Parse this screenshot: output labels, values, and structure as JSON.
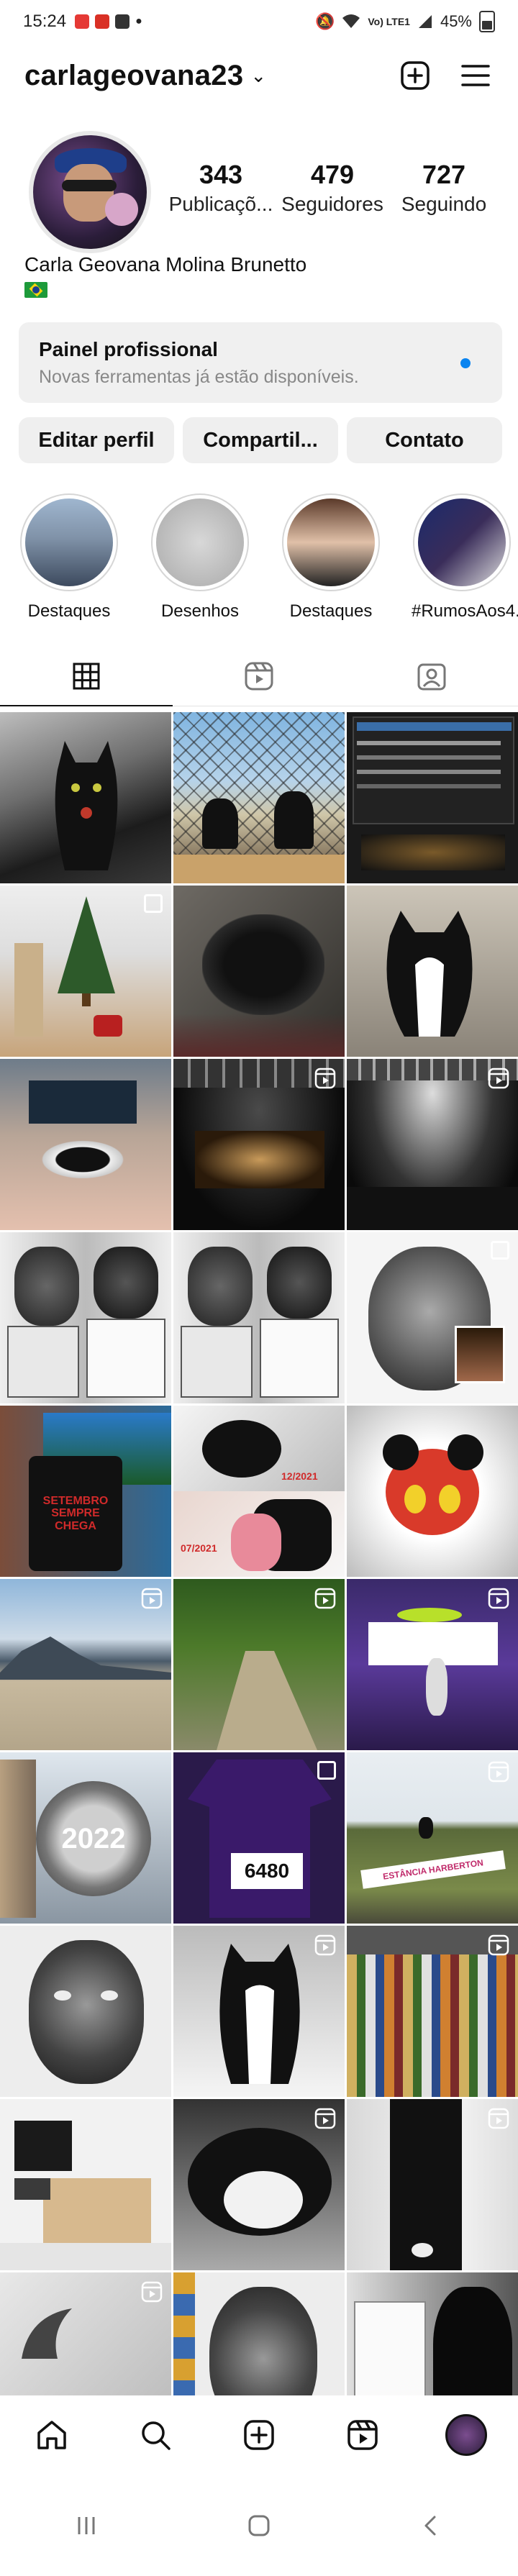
{
  "status_bar": {
    "time": "15:24",
    "network": "Vo) LTE1",
    "battery": "45%"
  },
  "header": {
    "username": "carlageovana23"
  },
  "profile": {
    "full_name": "Carla Geovana Molina Brunetto",
    "flag_icon": "brazil-flag-icon",
    "stats": [
      {
        "value": "343",
        "label": "Publicaçõ..."
      },
      {
        "value": "479",
        "label": "Seguidores"
      },
      {
        "value": "727",
        "label": "Seguindo"
      }
    ]
  },
  "pro_panel": {
    "title": "Painel profissional",
    "subtitle": "Novas ferramentas já estão disponíveis.",
    "dot_color": "#0a84f0"
  },
  "buttons": {
    "edit": "Editar perfil",
    "share": "Compartil...",
    "contact": "Contato"
  },
  "highlights": [
    {
      "label": "Destaques"
    },
    {
      "label": "Desenhos"
    },
    {
      "label": "Destaques"
    },
    {
      "label": "#RumosAos4..."
    }
  ],
  "tabs": [
    {
      "icon": "grid-icon",
      "active": true
    },
    {
      "icon": "reels-icon",
      "active": false
    },
    {
      "icon": "tagged-icon",
      "active": false
    }
  ],
  "grid_posts": [
    {
      "type": "reel"
    },
    {
      "type": "photo"
    },
    {
      "type": "photo"
    },
    {
      "type": "multi"
    },
    {
      "type": "photo"
    },
    {
      "type": "photo"
    },
    {
      "type": "photo"
    },
    {
      "type": "reel"
    },
    {
      "type": "reel"
    },
    {
      "type": "photo"
    },
    {
      "type": "photo"
    },
    {
      "type": "multi"
    },
    {
      "type": "photo"
    },
    {
      "type": "photo"
    },
    {
      "type": "photo"
    },
    {
      "type": "reel"
    },
    {
      "type": "reel"
    },
    {
      "type": "reel"
    },
    {
      "type": "photo"
    },
    {
      "type": "multi"
    },
    {
      "type": "reel"
    },
    {
      "type": "photo"
    },
    {
      "type": "reel"
    },
    {
      "type": "reel"
    },
    {
      "type": "photo"
    },
    {
      "type": "reel"
    },
    {
      "type": "reel"
    },
    {
      "type": "reel"
    },
    {
      "type": "photo"
    },
    {
      "type": "photo"
    }
  ],
  "post_texts": {
    "date_1": "12/2021",
    "date_2": "07/2021",
    "mug": "SETEMBRO SEMPRE CHEGA",
    "medal": "2022",
    "bib": "6480",
    "tag": "ESTÂNCIA HARBERTON"
  },
  "bottom_nav": [
    "home-icon",
    "search-icon",
    "create-icon",
    "reels-icon",
    "profile-avatar"
  ],
  "system_nav": [
    "recents-icon",
    "home-button-icon",
    "back-icon"
  ]
}
